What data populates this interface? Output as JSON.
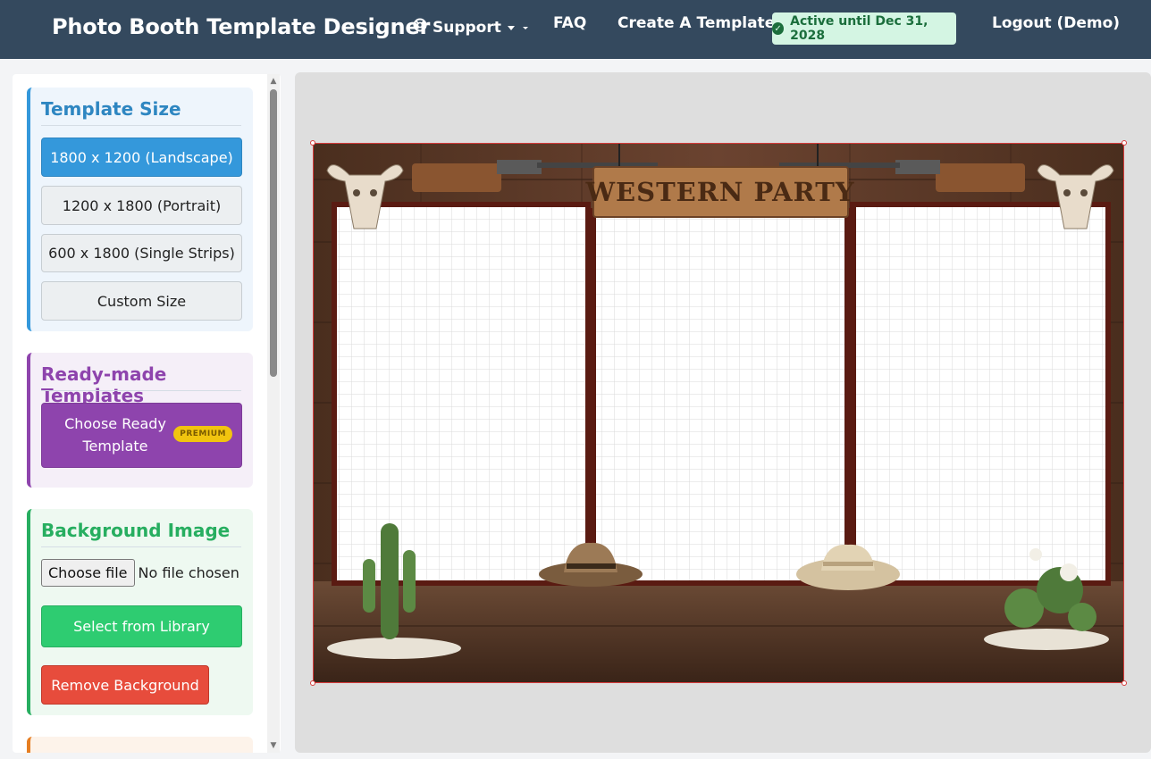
{
  "nav": {
    "brand": "Photo Booth Template Designer",
    "support_label": "Support",
    "support_icon": "lifebuoy-icon",
    "faq_label": "FAQ",
    "create_label": "Create A Template",
    "status_label": "Active until Dec 31, 2028",
    "logout_label": "Logout (Demo)"
  },
  "sidebar": {
    "template_size": {
      "title": "Template Size",
      "options": [
        {
          "label": "1800 x 1200 (Landscape)",
          "selected": true
        },
        {
          "label": "1200 x 1800 (Portrait)",
          "selected": false
        },
        {
          "label": "600 x 1800 (Single Strips)",
          "selected": false
        },
        {
          "label": "Custom Size",
          "selected": false
        }
      ]
    },
    "ready_made": {
      "title": "Ready-made Templates",
      "button_line1": "Choose Ready",
      "button_line2": "Template",
      "premium_badge": "PREMIUM"
    },
    "background": {
      "title": "Background Image",
      "choose_file_label": "Choose file",
      "no_file_text": "No file chosen",
      "library_button": "Select from Library",
      "remove_button": "Remove Background"
    }
  },
  "canvas": {
    "sign_text": "WESTERN PARTY",
    "photo_slots": 3
  },
  "colors": {
    "navbar": "#34495e",
    "primary": "#3498db",
    "purple": "#8e44ad",
    "green": "#2ecc71",
    "red": "#e74c3c",
    "status_bg": "#d4f5e3"
  }
}
